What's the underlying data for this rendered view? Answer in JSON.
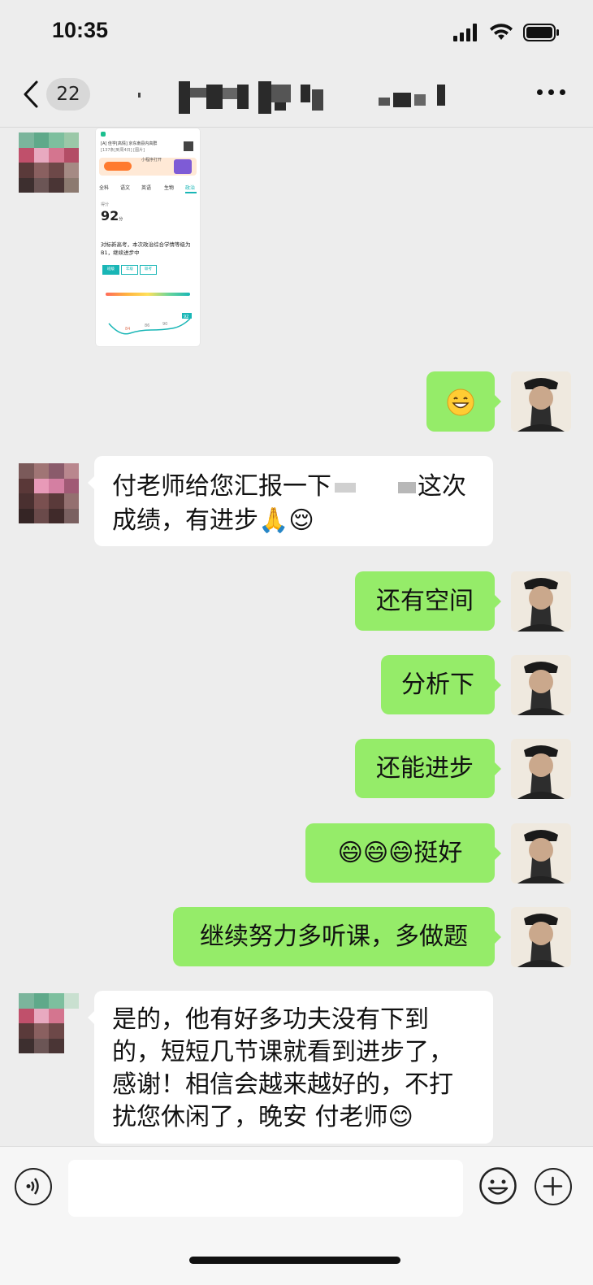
{
  "status_bar": {
    "time": "10:35"
  },
  "nav": {
    "unread_count": "22"
  },
  "messages": [
    {
      "id": "m1",
      "side": "in",
      "type": "image"
    },
    {
      "id": "m2",
      "side": "out",
      "text": "😄"
    },
    {
      "id": "m3",
      "side": "in",
      "text_line1": "付老师给您汇报一下",
      "text_line1_end": "这次",
      "text_line2": "成绩，有进步🙏😌"
    },
    {
      "id": "m4",
      "side": "out",
      "text": "还有空间"
    },
    {
      "id": "m5",
      "side": "out",
      "text": "分析下"
    },
    {
      "id": "m6",
      "side": "out",
      "text": "还能进步"
    },
    {
      "id": "m7",
      "side": "out",
      "text": "😄😄😄挺好"
    },
    {
      "id": "m8",
      "side": "out",
      "text": "继续努力多听课，多做题"
    },
    {
      "id": "m9",
      "side": "in",
      "lines": [
        "是的，他有好多功夫没有下到",
        "的，短短几节课就看到进步了，",
        "感谢！相信会越来越好的，不打",
        "扰您休闲了，晚安 付老师😊"
      ]
    }
  ],
  "image_card": {
    "header_text": "[A] 佳学[高情] 京东南县内高群",
    "header_sub": "[137条]到周4日] [图片]",
    "mini_link": "小程序打开",
    "tabs": [
      "全科",
      "语文",
      "英语",
      "生物",
      "政治"
    ],
    "score_label": "得分",
    "score": "92",
    "score_unit": "分",
    "summary": "对标新高考，本次政治综合学情等级为B1，继续进步中",
    "chips": [
      "班级",
      "年级",
      "联考"
    ],
    "chart_values": [
      "84",
      "86",
      "90",
      "92"
    ]
  },
  "colors": {
    "bubble_out": "#95ec69",
    "bubble_in": "#ffffff",
    "background": "#ededed"
  }
}
